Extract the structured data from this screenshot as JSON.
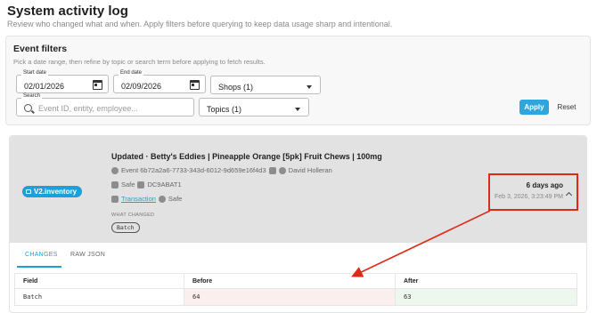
{
  "header": {
    "title": "System activity log",
    "subtitle": "Review who changed what and when. Apply filters before querying to keep data usage sharp and intentional."
  },
  "filters": {
    "title": "Event filters",
    "help": "Pick a date range, then refine by topic or search term before applying to fetch results.",
    "start_date": {
      "label": "Start date",
      "value": "02/01/2026"
    },
    "end_date": {
      "label": "End date",
      "value": "02/09/2026"
    },
    "shops": {
      "value": "Shops (1)"
    },
    "search": {
      "label": "Search",
      "placeholder": "Event ID, entity, employee..."
    },
    "topics": {
      "value": "Topics (1)"
    },
    "apply_label": "Apply",
    "reset_label": "Reset"
  },
  "event": {
    "badge": "V2.inventory",
    "title": "Updated · Betty's Eddies | Pineapple Orange [5pk] Fruit Chews | 100mg",
    "event_id": "Event 6b72a2a6-7733-343d-6012-9d659e16f4d3",
    "employee": "David Holleran",
    "location": "Safe",
    "code": "DC9ABAT1",
    "transaction_link": "Transaction",
    "transaction_location": "Safe",
    "what_changed_label": "WHAT CHANGED",
    "changed_field": "Batch",
    "relative_time": "6 days ago",
    "absolute_time": "Feb 3, 2026, 3:23:49 PM"
  },
  "tabs": [
    {
      "label": "CHANGES",
      "active": true
    },
    {
      "label": "RAW JSON",
      "active": false
    }
  ],
  "changes": {
    "headers": [
      "Field",
      "Before",
      "After"
    ],
    "rows": [
      {
        "field": "Batch",
        "before": "64",
        "after": "63"
      }
    ]
  },
  "colors": {
    "accent": "#1f9fd8",
    "annotation": "#e02a18"
  }
}
